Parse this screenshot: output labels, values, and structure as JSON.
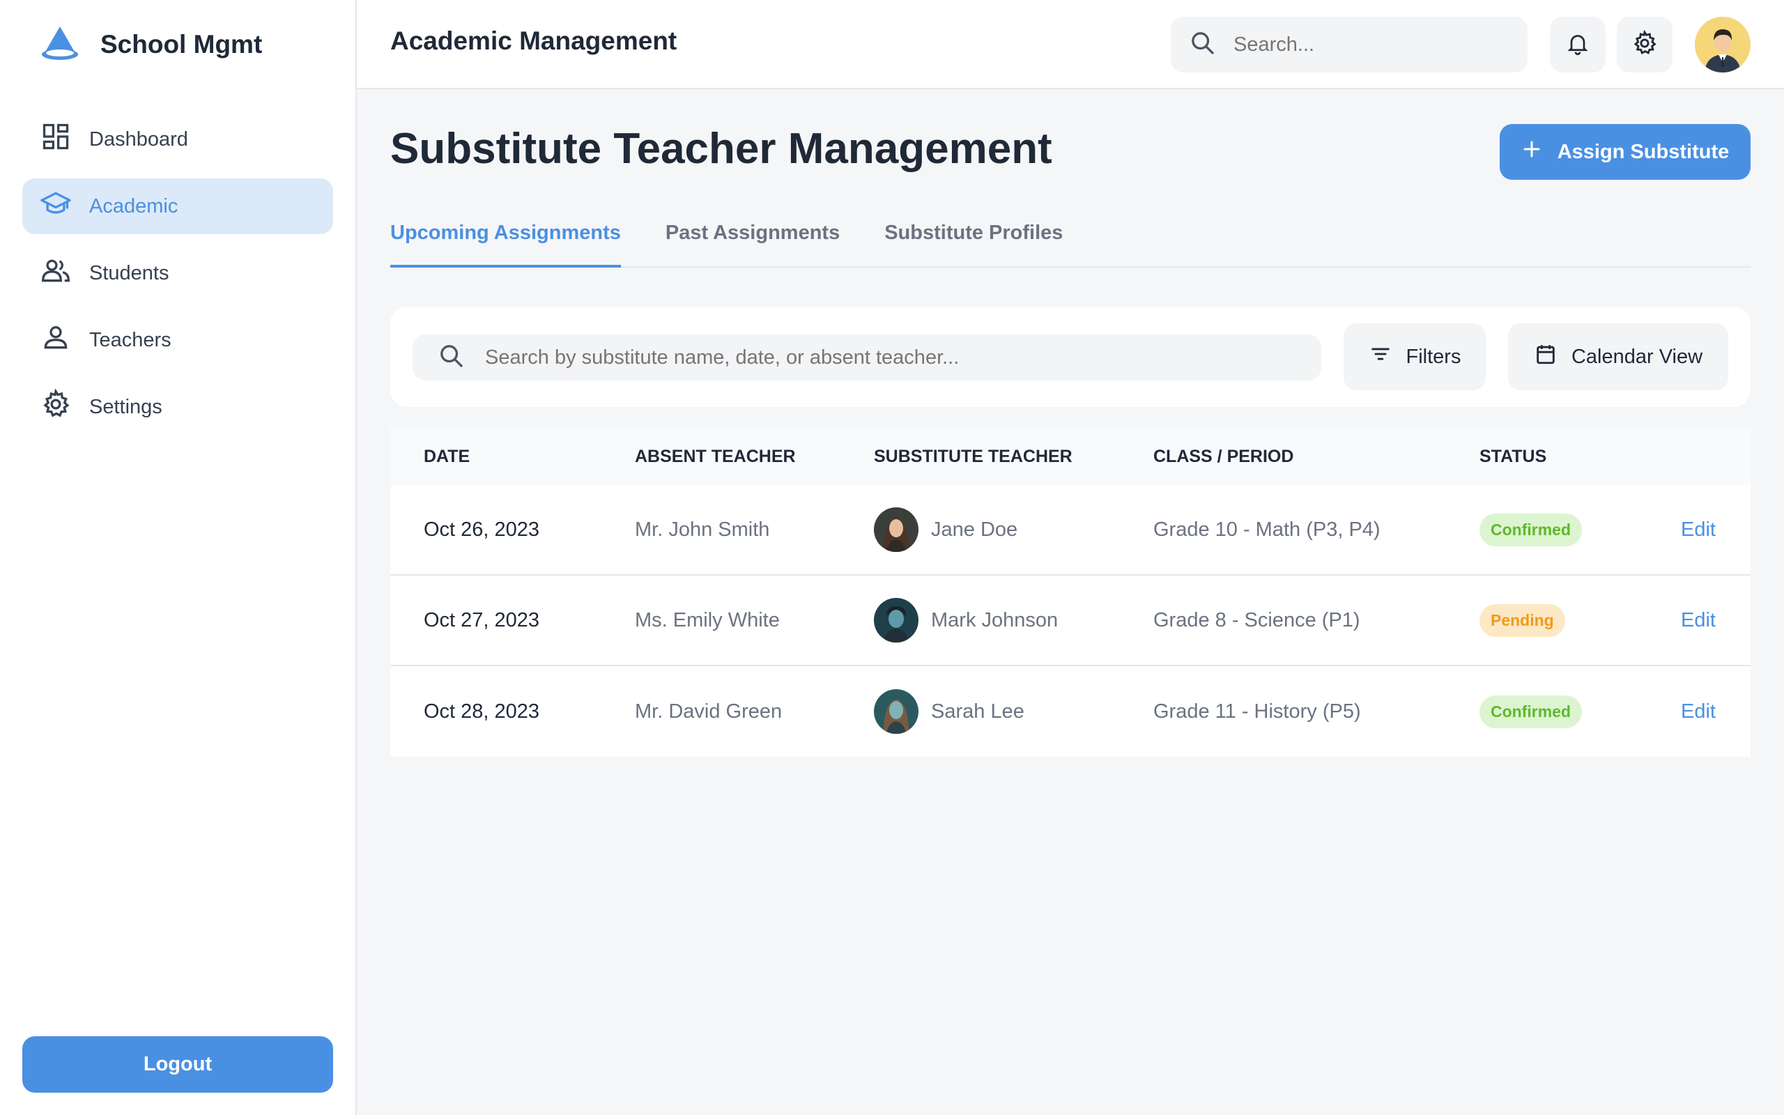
{
  "sidebar": {
    "brand": "School Mgmt",
    "items": [
      {
        "label": "Dashboard",
        "icon": "dashboard-icon"
      },
      {
        "label": "Academic",
        "icon": "graduation-cap-icon",
        "active": true
      },
      {
        "label": "Students",
        "icon": "users-icon"
      },
      {
        "label": "Teachers",
        "icon": "person-icon"
      },
      {
        "label": "Settings",
        "icon": "gear-icon"
      }
    ],
    "logout_label": "Logout"
  },
  "header": {
    "title": "Academic Management",
    "search_placeholder": "Search..."
  },
  "main": {
    "title": "Substitute Teacher Management",
    "assign_label": "Assign Substitute",
    "tabs": [
      {
        "label": "Upcoming Assignments",
        "active": true
      },
      {
        "label": "Past Assignments"
      },
      {
        "label": "Substitute Profiles"
      }
    ],
    "filter": {
      "search_placeholder": "Search by substitute name, date, or absent teacher...",
      "filters_label": "Filters",
      "calendar_label": "Calendar View"
    },
    "table": {
      "headers": [
        "DATE",
        "ABSENT TEACHER",
        "SUBSTITUTE TEACHER",
        "CLASS / PERIOD",
        "STATUS"
      ],
      "rows": [
        {
          "date": "Oct 26, 2023",
          "absent": "Mr. John Smith",
          "substitute": "Jane Doe",
          "class": "Grade 10 - Math (P3, P4)",
          "status": "Confirmed",
          "action": "Edit"
        },
        {
          "date": "Oct 27, 2023",
          "absent": "Ms. Emily White",
          "substitute": "Mark Johnson",
          "class": "Grade 8 - Science (P1)",
          "status": "Pending",
          "action": "Edit"
        },
        {
          "date": "Oct 28, 2023",
          "absent": "Mr. David Green",
          "substitute": "Sarah Lee",
          "class": "Grade 11 - History (P5)",
          "status": "Confirmed",
          "action": "Edit"
        }
      ]
    }
  },
  "colors": {
    "accent": "#4a90e2",
    "confirmed": "#5fb82c",
    "pending": "#f19a1a"
  }
}
